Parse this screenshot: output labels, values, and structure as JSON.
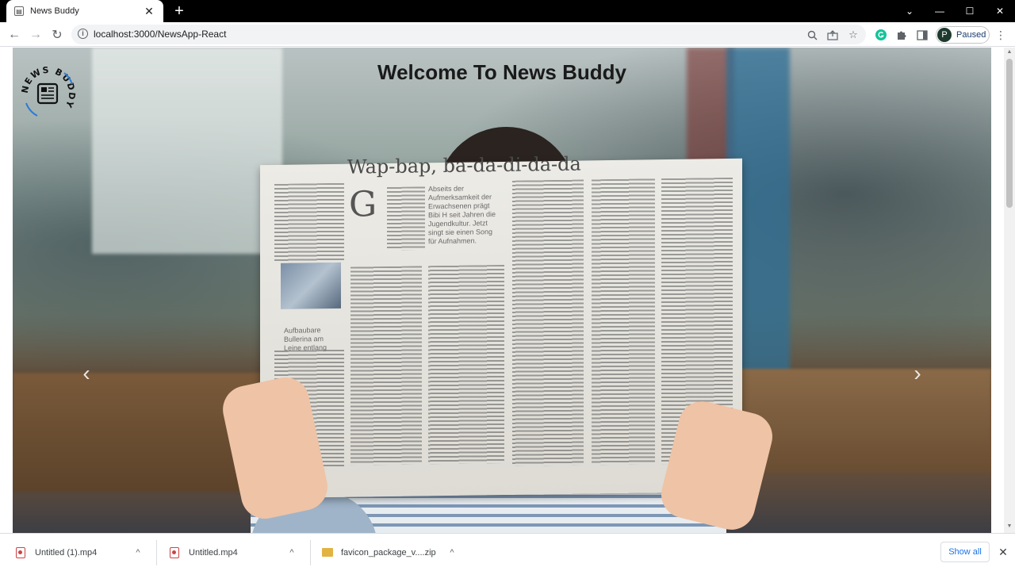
{
  "browser": {
    "tab": {
      "title": "News Buddy",
      "close_glyph": "✕"
    },
    "new_tab_glyph": "+",
    "window_controls": {
      "tab_search": "⌄",
      "minimize": "—",
      "maximize": "☐",
      "close": "✕"
    },
    "nav": {
      "back": "←",
      "forward": "→",
      "reload": "↻"
    },
    "address_bar": {
      "url": "localhost:3000/NewsApp-React"
    },
    "omnibox_icons": [
      "zoom-icon",
      "share-icon",
      "bookmark-star-icon"
    ],
    "extensions": [
      "grammarly-icon",
      "puzzle-extensions-icon",
      "side-panel-icon"
    ],
    "profile": {
      "initial": "P",
      "status": "Paused"
    },
    "menu_glyph": "⋮"
  },
  "page": {
    "title": "Welcome To News Buddy",
    "logo_text": "NEWS BUDDY",
    "newspaper_headline": "Wap-bap, ba-da-di-da-da",
    "carousel": {
      "prev_glyph": "‹",
      "next_glyph": "›"
    }
  },
  "downloads": {
    "items": [
      {
        "name": "Untitled (1).mp4",
        "type": "video"
      },
      {
        "name": "Untitled.mp4",
        "type": "video"
      },
      {
        "name": "favicon_package_v....zip",
        "type": "zip"
      }
    ],
    "chevron_glyph": "^",
    "show_all_label": "Show all",
    "close_glyph": "✕"
  },
  "colors": {
    "tabstrip": "#000000",
    "link_blue": "#1a73e8",
    "profile_avatar": "#1e3a2f"
  }
}
